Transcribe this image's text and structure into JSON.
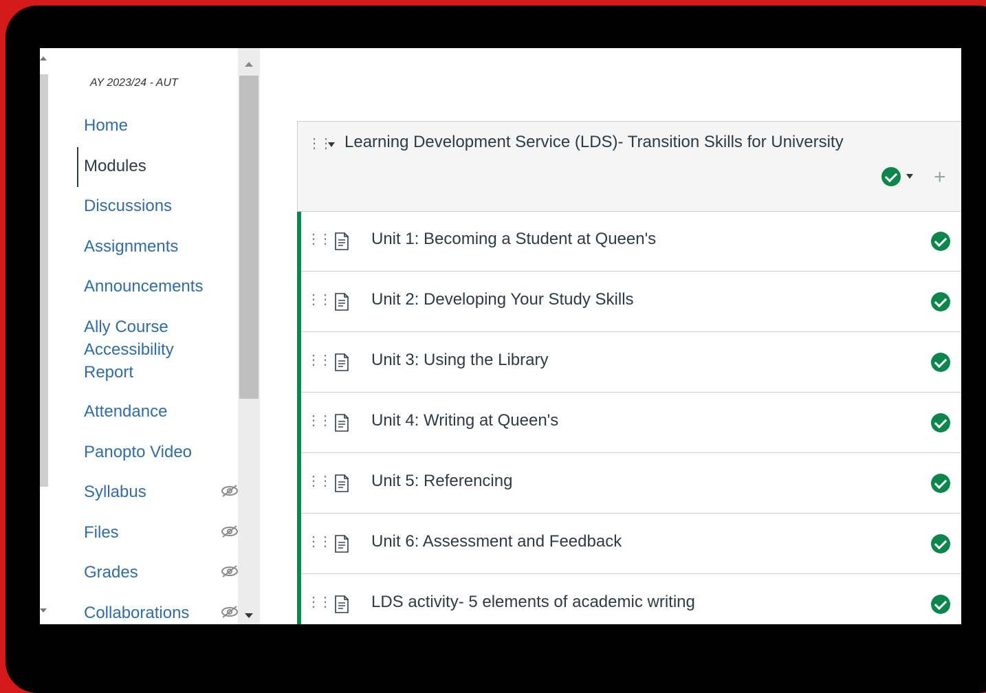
{
  "course_nav": {
    "term": "AY 2023/24 - AUT",
    "items": [
      {
        "label": "Home",
        "active": false,
        "hidden": false
      },
      {
        "label": "Modules",
        "active": true,
        "hidden": false
      },
      {
        "label": "Discussions",
        "active": false,
        "hidden": false
      },
      {
        "label": "Assignments",
        "active": false,
        "hidden": false
      },
      {
        "label": "Announcements",
        "active": false,
        "hidden": false
      },
      {
        "label": "Ally Course Accessibility Report",
        "active": false,
        "hidden": false
      },
      {
        "label": "Attendance",
        "active": false,
        "hidden": false
      },
      {
        "label": "Panopto Video",
        "active": false,
        "hidden": false
      },
      {
        "label": "Syllabus",
        "active": false,
        "hidden": true
      },
      {
        "label": "Files",
        "active": false,
        "hidden": true
      },
      {
        "label": "Grades",
        "active": false,
        "hidden": true
      },
      {
        "label": "Collaborations",
        "active": false,
        "hidden": true
      }
    ]
  },
  "module": {
    "title": "Learning Development Service (LDS)- Transition Skills for University",
    "published": true,
    "items": [
      {
        "title": "Unit 1: Becoming a Student at Queen's",
        "published": true
      },
      {
        "title": "Unit 2: Developing Your Study Skills",
        "published": true
      },
      {
        "title": "Unit 3: Using the Library",
        "published": true
      },
      {
        "title": "Unit 4: Writing at Queen's",
        "published": true
      },
      {
        "title": "Unit 5: Referencing",
        "published": true
      },
      {
        "title": "Unit 6: Assessment and Feedback",
        "published": true
      },
      {
        "title": "LDS activity- 5 elements of academic writing",
        "published": true
      }
    ]
  },
  "colors": {
    "link": "#2d6ea8",
    "text": "#2d3b45",
    "published_green": "#0b874b",
    "frame_red": "#d41a1a"
  }
}
